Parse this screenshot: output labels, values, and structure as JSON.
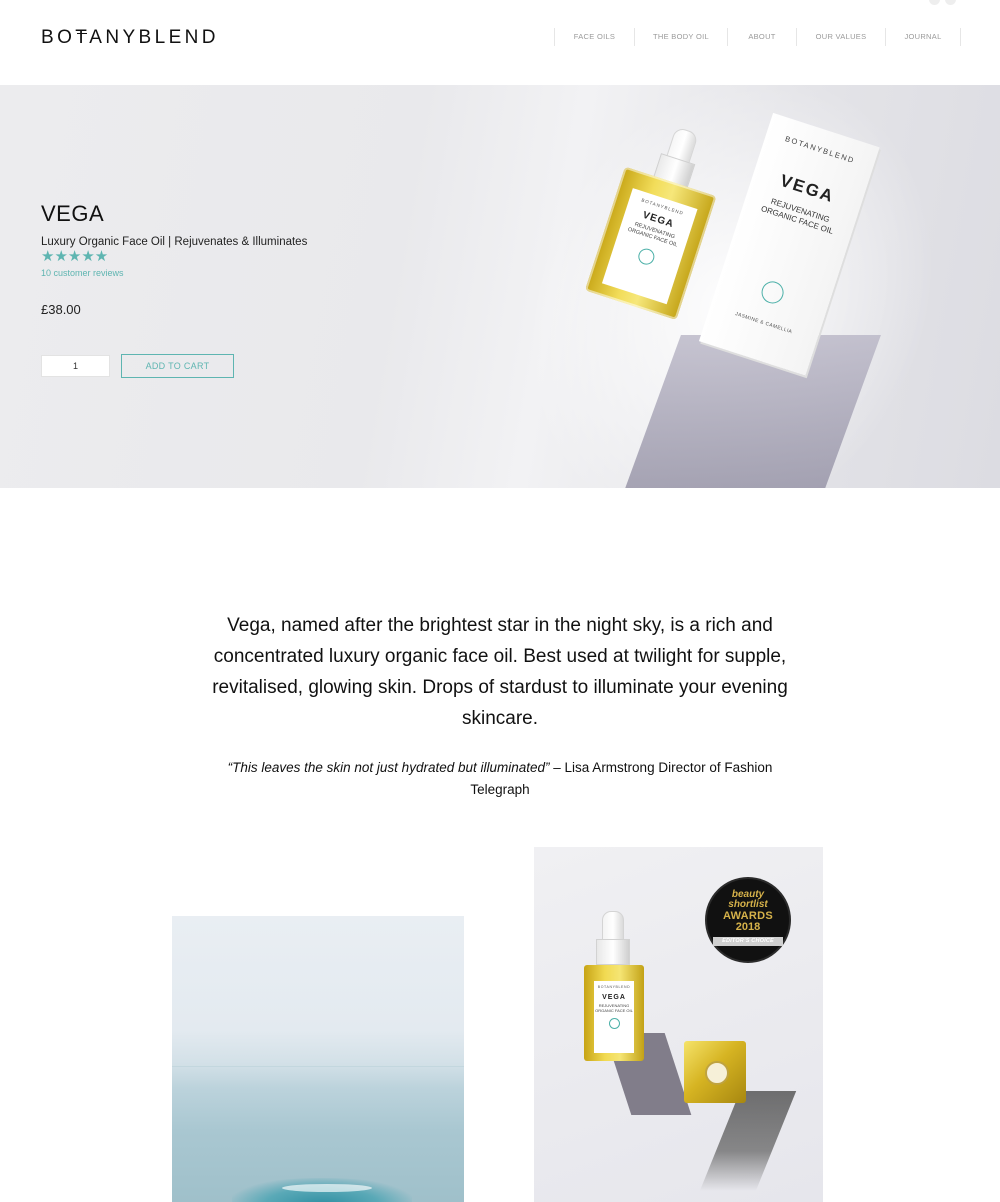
{
  "brand": {
    "logo_left": "BO",
    "logo_t": "T",
    "logo_right": "ANYBLEND"
  },
  "nav": {
    "items": [
      "FACE OILS",
      "THE BODY OIL",
      "ABOUT",
      "OUR VALUES",
      "JOURNAL"
    ]
  },
  "product": {
    "title": "VEGA",
    "subtitle": "Luxury Organic Face Oil | Rejuvenates & Illuminates",
    "rating": 5,
    "stars": "★★★★★",
    "reviews": "10 customer reviews",
    "price": "£38.00",
    "quantity": "1",
    "add_to_cart": "ADD TO CART"
  },
  "hero_packaging": {
    "bottle_brand": "BOTANYBLEND",
    "bottle_name": "VEGA",
    "bottle_type_1": "REJUVENATING",
    "bottle_type_2": "ORGANIC FACE OIL",
    "box_brand": "BOTANYBLEND",
    "box_name": "VEGA",
    "box_type_1": "REJUVENATING",
    "box_type_2": "ORGANIC FACE OIL",
    "box_scent": "JASMINE & CAMELLIA"
  },
  "intro": {
    "text": "Vega, named after the brightest star in the night sky, is a rich and concentrated luxury organic face oil. Best used at twilight for supple, revitalised, glowing skin. Drops of stardust to illuminate your evening skincare."
  },
  "quote": {
    "text": "“This leaves the skin not just hydrated but illuminated”",
    "attribution": " – Lisa Armstrong Director of Fashion Telegraph"
  },
  "award": {
    "line1": "beauty",
    "line2": "shortlist",
    "line3": "AWARDS",
    "line4": "2018",
    "ribbon": "EDITOR’S CHOICE"
  },
  "colors": {
    "accent": "#5eb5b1",
    "text": "#111111",
    "nav": "#9a9a9a"
  }
}
